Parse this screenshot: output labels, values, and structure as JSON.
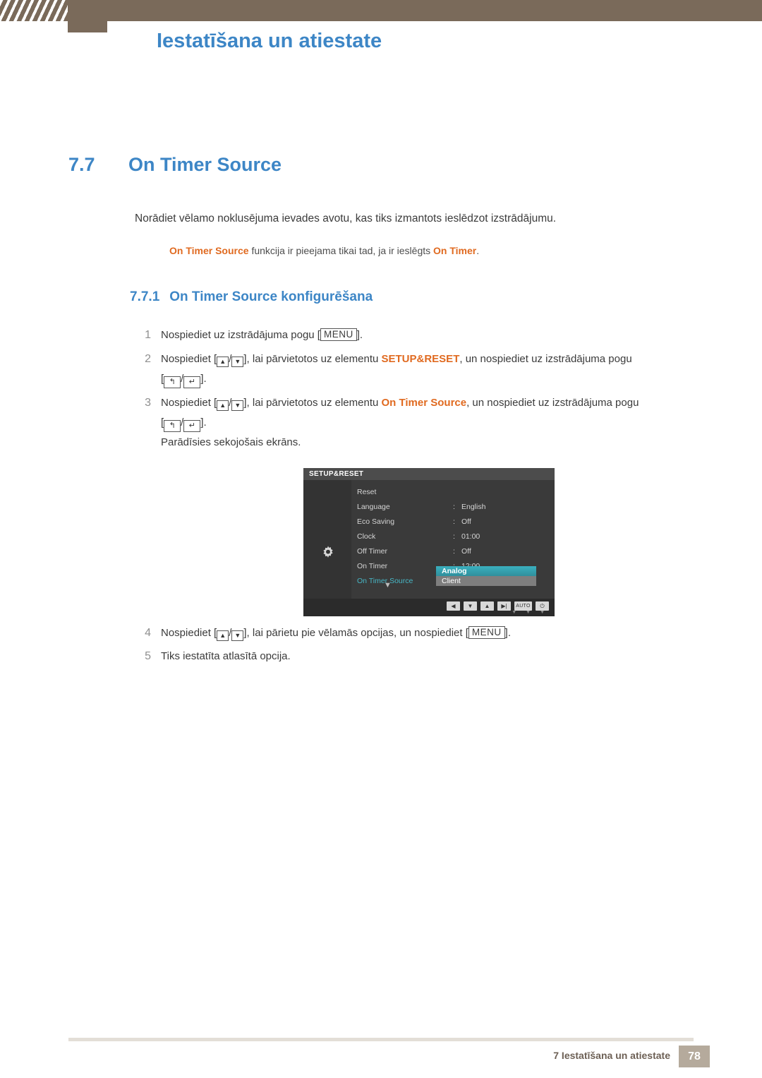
{
  "header": {
    "chapter_title": "Iestatīšana un atiestate"
  },
  "section": {
    "number": "7.7",
    "title": "On Timer Source"
  },
  "intro": "Norādiet vēlamo noklusējuma ievades avotu, kas tiks izmantots ieslēdzot izstrādājumu.",
  "note": {
    "hl1": "On Timer Source",
    "mid": " funkcija ir pieejama tikai tad, ja ir ieslēgts ",
    "hl2": "On Timer",
    "end": "."
  },
  "subsection": {
    "number": "7.7.1",
    "title": "On Timer Source konfigurēšana"
  },
  "steps": [
    {
      "index": "1",
      "pre": "Nospiediet uz izstrādājuma pogu [",
      "key": "MENU",
      "post": "]."
    },
    {
      "index": "2",
      "pre": "Nospiediet [",
      "sep": "/",
      "mid": "], lai pārvietotos uz elementu ",
      "hl": "SETUP&RESET",
      "post": ", un nospiediet uz izstrādājuma pogu",
      "line2_pre": "[",
      "line2_sep": "/",
      "line2_post": "]."
    },
    {
      "index": "3",
      "pre": "Nospiediet [",
      "sep": "/",
      "mid": "], lai pārvietotos uz elementu ",
      "hl": "On Timer Source",
      "post": ", un nospiediet uz izstrādājuma pogu",
      "line2_pre": "[",
      "line2_sep": "/",
      "line2_post": "].",
      "line3": "Parādīsies sekojošais ekrāns."
    },
    {
      "index": "4",
      "pre": "Nospiediet [",
      "sep": "/",
      "mid": "], lai pārietu pie vēlamās opcijas, un nospiediet [",
      "key": "MENU",
      "post": "]."
    },
    {
      "index": "5",
      "text": "Tiks iestatīta atlasītā opcija."
    }
  ],
  "osd": {
    "title": "SETUP&RESET",
    "rows": [
      {
        "label": "Reset",
        "colon": "",
        "value": ""
      },
      {
        "label": "Language",
        "colon": ":",
        "value": "English"
      },
      {
        "label": "Eco Saving",
        "colon": ":",
        "value": "Off"
      },
      {
        "label": "Clock",
        "colon": ":",
        "value": "01:00"
      },
      {
        "label": "Off Timer",
        "colon": ":",
        "value": "Off"
      },
      {
        "label": "On Timer",
        "colon": ":",
        "value": "12:00"
      },
      {
        "label": "On Timer Source",
        "colon": ":",
        "value": ""
      }
    ],
    "selected_index": 6,
    "down_arrow": "▼",
    "popup": {
      "options": [
        {
          "label": "Analog",
          "state": "on"
        },
        {
          "label": "Client",
          "state": "off"
        }
      ]
    },
    "buttons": [
      {
        "name": "left",
        "glyph": "◀"
      },
      {
        "name": "down",
        "glyph": "▼"
      },
      {
        "name": "up",
        "glyph": "▲"
      },
      {
        "name": "source",
        "glyph": "▶|"
      },
      {
        "name": "auto",
        "glyph": "AUTO"
      },
      {
        "name": "power",
        "glyph": "⏻"
      }
    ],
    "dots": [
      "▼",
      "▼",
      "▼"
    ]
  },
  "footer": {
    "text": "7 Iestatīšana un atiestate",
    "page": "78"
  }
}
